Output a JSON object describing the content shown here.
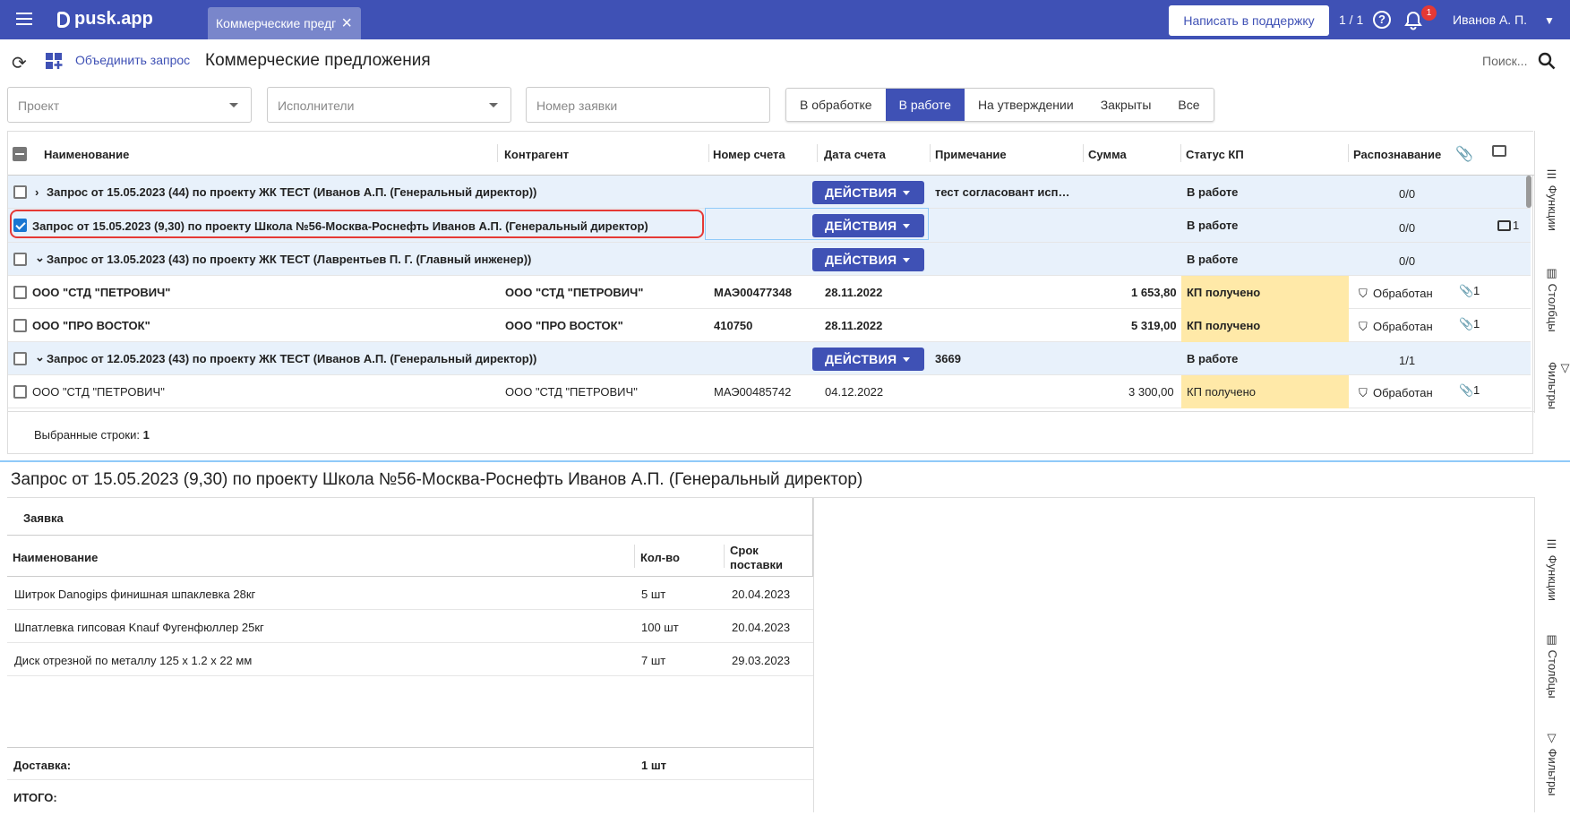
{
  "topbar": {
    "logo": "pusk.app",
    "tab_label": "Коммерческие предг",
    "support_button": "Написать в поддержку",
    "pager": "1 / 1",
    "help_glyph": "?",
    "notifications_count": "1",
    "user": "Иванов А. П."
  },
  "toolbar": {
    "merge_label": "Объединить запрос",
    "page_title": "Коммерческие предложения",
    "search_placeholder": "Поиск..."
  },
  "filters": {
    "project": "Проект",
    "executors": "Исполнители",
    "request_number": "Номер заявки",
    "status_tabs": [
      "В обработке",
      "В работе",
      "На утверждении",
      "Закрыты",
      "Все"
    ],
    "active_tab": "В работе"
  },
  "table": {
    "columns": [
      "Наименование",
      "Контрагент",
      "Номер счета",
      "Дата счета",
      "Примечание",
      "Сумма",
      "Статус КП",
      "Распознавание"
    ],
    "action_label": "ДЕЙСТВИЯ",
    "rows": [
      {
        "type": "group",
        "chevron": "›",
        "name": "Запрос от 15.05.2023 (44) по проекту ЖК ТЕСТ (Иванов А.П. (Генеральный директор))",
        "note": "тест согласовант исп…",
        "status": "В работе",
        "recog": "0/0",
        "checked": false
      },
      {
        "type": "group",
        "chevron": "",
        "name": "Запрос от 15.05.2023 (9,30) по проекту Школа №56-Москва-Роснефть Иванов А.П. (Генеральный директор)",
        "note": "",
        "status": "В работе",
        "recog": "0/0",
        "comments": "1",
        "checked": true
      },
      {
        "type": "group",
        "chevron": "⌄",
        "name": "Запрос от 13.05.2023 (43) по проекту ЖК ТЕСТ (Лаврентьев П. Г. (Главный инженер))",
        "note": "",
        "status": "В работе",
        "recog": "0/0",
        "checked": false
      },
      {
        "type": "item",
        "bold": true,
        "name": "ООО \"СТД \"ПЕТРОВИЧ\"",
        "contractor": "ООО \"СТД \"ПЕТРОВИЧ\"",
        "invoice": "МАЭ00477348",
        "date": "28.11.2022",
        "sum": "1 653,80",
        "status": "КП получено",
        "recog": "Обработан",
        "attach": "1"
      },
      {
        "type": "item",
        "bold": true,
        "name": "ООО \"ПРО ВОСТОК\"",
        "contractor": "ООО \"ПРО ВОСТОК\"",
        "invoice": "410750",
        "date": "28.11.2022",
        "sum": "5 319,00",
        "status": "КП получено",
        "recog": "Обработан",
        "attach": "1"
      },
      {
        "type": "group",
        "chevron": "⌄",
        "name": "Запрос от 12.05.2023 (43) по проекту ЖК ТЕСТ (Иванов А.П. (Генеральный директор))",
        "note": "3669",
        "status": "В работе",
        "recog": "1/1",
        "checked": false
      },
      {
        "type": "item",
        "bold": false,
        "name": "ООО \"СТД \"ПЕТРОВИЧ\"",
        "contractor": "ООО \"СТД \"ПЕТРОВИЧ\"",
        "invoice": "МАЭ00485742",
        "date": "04.12.2022",
        "sum": "3 300,00",
        "status": "КП получено",
        "recog": "Обработан",
        "attach": "1"
      }
    ],
    "selected_label": "Выбранные строки:",
    "selected_count": "1"
  },
  "side_tabs": [
    "Функции",
    "Столбцы",
    "Фильтры"
  ],
  "detail": {
    "title": "Запрос от 15.05.2023 (9,30) по проекту Школа №56-Москва-Роснефть Иванов А.П. (Генеральный директор)",
    "group_header": "Заявка",
    "columns": [
      "Наименование",
      "Кол-во",
      "Срок поставки"
    ],
    "rows": [
      {
        "name": "Шитрок Danogips финишная шпаклевка 28кг",
        "qty": "5 шт",
        "date": "20.04.2023"
      },
      {
        "name": "Шпатлевка гипсовая Knauf Фугенфюллер 25кг",
        "qty": "100 шт",
        "date": "20.04.2023"
      },
      {
        "name": "Диск отрезной по металлу 125 х 1.2 х 22 мм",
        "qty": "7 шт",
        "date": "29.03.2023"
      }
    ],
    "delivery_label": "Доставка:",
    "delivery_value": "1 шт",
    "total_label": "ИТОГО:"
  }
}
